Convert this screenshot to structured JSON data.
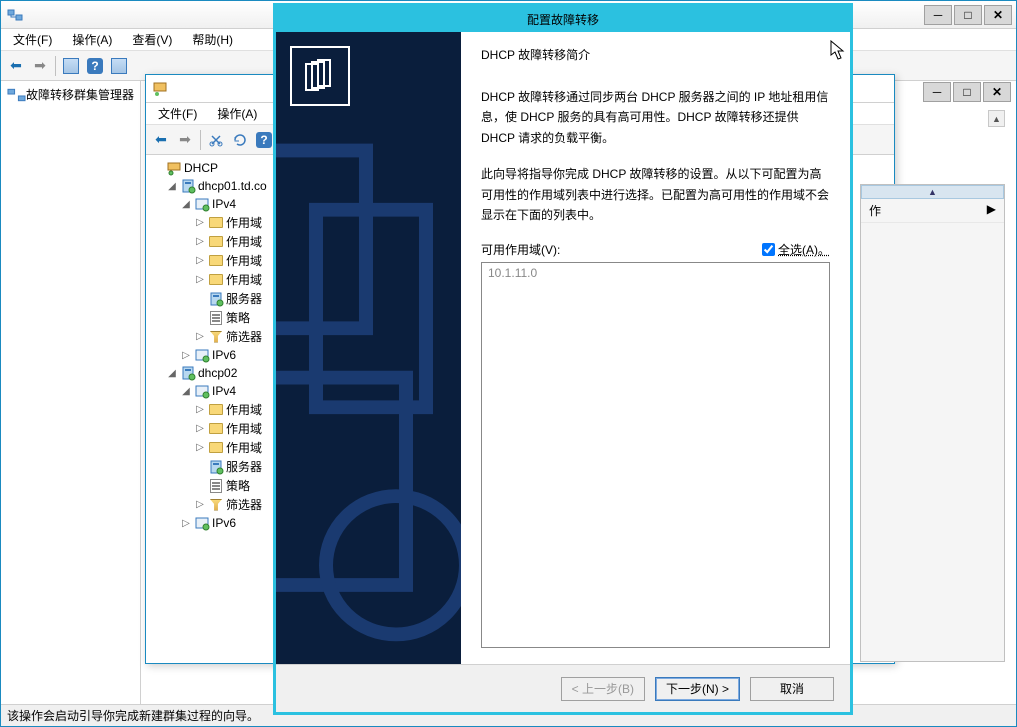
{
  "main_window": {
    "title": "故障转移群集管理器",
    "menus": [
      "文件(F)",
      "操作(A)",
      "查看(V)",
      "帮助(H)"
    ],
    "left_pane_label": "故障转移群集管理器",
    "statusbar": "该操作会启动引导你完成新建群集过程的向导。"
  },
  "dhcp_window": {
    "menus": [
      "文件(F)",
      "操作(A)"
    ],
    "tree": [
      {
        "indent": 0,
        "toggle": "",
        "icon": "dhcp",
        "label": "DHCP"
      },
      {
        "indent": 1,
        "toggle": "◢",
        "icon": "server",
        "label": "dhcp01.td.co"
      },
      {
        "indent": 2,
        "toggle": "◢",
        "icon": "ipv",
        "label": "IPv4"
      },
      {
        "indent": 3,
        "toggle": "▷",
        "icon": "folder",
        "label": "作用域"
      },
      {
        "indent": 3,
        "toggle": "▷",
        "icon": "folder",
        "label": "作用域"
      },
      {
        "indent": 3,
        "toggle": "▷",
        "icon": "folder",
        "label": "作用域"
      },
      {
        "indent": 3,
        "toggle": "▷",
        "icon": "folder",
        "label": "作用域"
      },
      {
        "indent": 3,
        "toggle": "",
        "icon": "server",
        "label": "服务器"
      },
      {
        "indent": 3,
        "toggle": "",
        "icon": "policy",
        "label": "策略"
      },
      {
        "indent": 3,
        "toggle": "▷",
        "icon": "filter",
        "label": "筛选器"
      },
      {
        "indent": 2,
        "toggle": "▷",
        "icon": "ipv",
        "label": "IPv6"
      },
      {
        "indent": 1,
        "toggle": "◢",
        "icon": "server",
        "label": "dhcp02"
      },
      {
        "indent": 2,
        "toggle": "◢",
        "icon": "ipv",
        "label": "IPv4"
      },
      {
        "indent": 3,
        "toggle": "▷",
        "icon": "folder",
        "label": "作用域"
      },
      {
        "indent": 3,
        "toggle": "▷",
        "icon": "folder",
        "label": "作用域"
      },
      {
        "indent": 3,
        "toggle": "▷",
        "icon": "folder",
        "label": "作用域"
      },
      {
        "indent": 3,
        "toggle": "",
        "icon": "server",
        "label": "服务器"
      },
      {
        "indent": 3,
        "toggle": "",
        "icon": "policy",
        "label": "策略"
      },
      {
        "indent": 3,
        "toggle": "▷",
        "icon": "filter",
        "label": "筛选器"
      },
      {
        "indent": 2,
        "toggle": "▷",
        "icon": "ipv",
        "label": "IPv6"
      }
    ]
  },
  "action_pane": {
    "action_label": "作"
  },
  "wizard": {
    "title": "配置故障转移",
    "heading": "DHCP 故障转移简介",
    "para1": "DHCP 故障转移通过同步两台 DHCP 服务器之间的 IP 地址租用信息，使 DHCP 服务的具有高可用性。DHCP 故障转移还提供 DHCP 请求的负载平衡。",
    "para2": "此向导将指导你完成 DHCP 故障转移的设置。从以下可配置为高可用性的作用域列表中进行选择。已配置为高可用性的作用域不会显示在下面的列表中。",
    "scope_label": "可用作用域(V):",
    "select_all_label": "全选(A)。",
    "scope_items": [
      "10.1.11.0"
    ],
    "btn_back": "< 上一步(B)",
    "btn_next": "下一步(N) >",
    "btn_cancel": "取消"
  }
}
